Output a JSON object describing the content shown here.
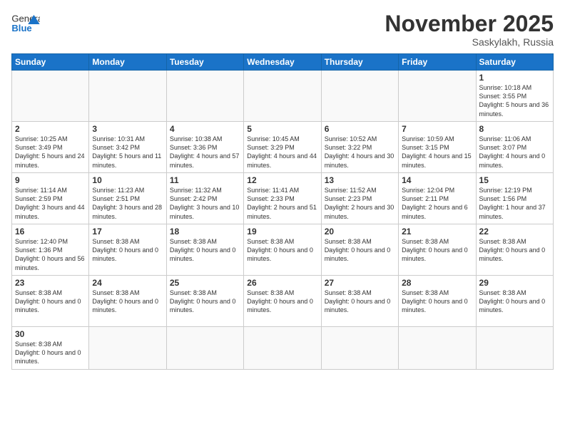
{
  "header": {
    "logo_general": "General",
    "logo_blue": "Blue",
    "month_title": "November 2025",
    "location": "Saskylakh, Russia"
  },
  "weekdays": [
    "Sunday",
    "Monday",
    "Tuesday",
    "Wednesday",
    "Thursday",
    "Friday",
    "Saturday"
  ],
  "weeks": [
    [
      {
        "day": "",
        "info": ""
      },
      {
        "day": "",
        "info": ""
      },
      {
        "day": "",
        "info": ""
      },
      {
        "day": "",
        "info": ""
      },
      {
        "day": "",
        "info": ""
      },
      {
        "day": "",
        "info": ""
      },
      {
        "day": "1",
        "info": "Sunrise: 10:18 AM\nSunset: 3:55 PM\nDaylight: 5 hours\nand 36 minutes."
      }
    ],
    [
      {
        "day": "2",
        "info": "Sunrise: 10:25 AM\nSunset: 3:49 PM\nDaylight: 5 hours\nand 24 minutes."
      },
      {
        "day": "3",
        "info": "Sunrise: 10:31 AM\nSunset: 3:42 PM\nDaylight: 5 hours\nand 11 minutes."
      },
      {
        "day": "4",
        "info": "Sunrise: 10:38 AM\nSunset: 3:36 PM\nDaylight: 4 hours\nand 57 minutes."
      },
      {
        "day": "5",
        "info": "Sunrise: 10:45 AM\nSunset: 3:29 PM\nDaylight: 4 hours\nand 44 minutes."
      },
      {
        "day": "6",
        "info": "Sunrise: 10:52 AM\nSunset: 3:22 PM\nDaylight: 4 hours\nand 30 minutes."
      },
      {
        "day": "7",
        "info": "Sunrise: 10:59 AM\nSunset: 3:15 PM\nDaylight: 4 hours\nand 15 minutes."
      },
      {
        "day": "8",
        "info": "Sunrise: 11:06 AM\nSunset: 3:07 PM\nDaylight: 4 hours\nand 0 minutes."
      }
    ],
    [
      {
        "day": "9",
        "info": "Sunrise: 11:14 AM\nSunset: 2:59 PM\nDaylight: 3 hours\nand 44 minutes."
      },
      {
        "day": "10",
        "info": "Sunrise: 11:23 AM\nSunset: 2:51 PM\nDaylight: 3 hours\nand 28 minutes."
      },
      {
        "day": "11",
        "info": "Sunrise: 11:32 AM\nSunset: 2:42 PM\nDaylight: 3 hours\nand 10 minutes."
      },
      {
        "day": "12",
        "info": "Sunrise: 11:41 AM\nSunset: 2:33 PM\nDaylight: 2 hours\nand 51 minutes."
      },
      {
        "day": "13",
        "info": "Sunrise: 11:52 AM\nSunset: 2:23 PM\nDaylight: 2 hours\nand 30 minutes."
      },
      {
        "day": "14",
        "info": "Sunrise: 12:04 PM\nSunset: 2:11 PM\nDaylight: 2 hours\nand 6 minutes."
      },
      {
        "day": "15",
        "info": "Sunrise: 12:19 PM\nSunset: 1:56 PM\nDaylight: 1 hour and\n37 minutes."
      }
    ],
    [
      {
        "day": "16",
        "info": "Sunrise: 12:40 PM\nSunset: 1:36 PM\nDaylight: 0 hours\nand 56 minutes."
      },
      {
        "day": "17",
        "info": "Sunset: 8:38 AM\nDaylight: 0 hours\nand 0 minutes."
      },
      {
        "day": "18",
        "info": "Sunset: 8:38 AM\nDaylight: 0 hours\nand 0 minutes."
      },
      {
        "day": "19",
        "info": "Sunset: 8:38 AM\nDaylight: 0 hours\nand 0 minutes."
      },
      {
        "day": "20",
        "info": "Sunset: 8:38 AM\nDaylight: 0 hours\nand 0 minutes."
      },
      {
        "day": "21",
        "info": "Sunset: 8:38 AM\nDaylight: 0 hours\nand 0 minutes."
      },
      {
        "day": "22",
        "info": "Sunset: 8:38 AM\nDaylight: 0 hours\nand 0 minutes."
      }
    ],
    [
      {
        "day": "23",
        "info": "Sunset: 8:38 AM\nDaylight: 0 hours\nand 0 minutes."
      },
      {
        "day": "24",
        "info": "Sunset: 8:38 AM\nDaylight: 0 hours\nand 0 minutes."
      },
      {
        "day": "25",
        "info": "Sunset: 8:38 AM\nDaylight: 0 hours\nand 0 minutes."
      },
      {
        "day": "26",
        "info": "Sunset: 8:38 AM\nDaylight: 0 hours\nand 0 minutes."
      },
      {
        "day": "27",
        "info": "Sunset: 8:38 AM\nDaylight: 0 hours\nand 0 minutes."
      },
      {
        "day": "28",
        "info": "Sunset: 8:38 AM\nDaylight: 0 hours\nand 0 minutes."
      },
      {
        "day": "29",
        "info": "Sunset: 8:38 AM\nDaylight: 0 hours\nand 0 minutes."
      }
    ],
    [
      {
        "day": "30",
        "info": "Sunset: 8:38 AM\nDaylight: 0 hours\nand 0 minutes."
      },
      {
        "day": "",
        "info": ""
      },
      {
        "day": "",
        "info": ""
      },
      {
        "day": "",
        "info": ""
      },
      {
        "day": "",
        "info": ""
      },
      {
        "day": "",
        "info": ""
      },
      {
        "day": "",
        "info": ""
      }
    ]
  ]
}
